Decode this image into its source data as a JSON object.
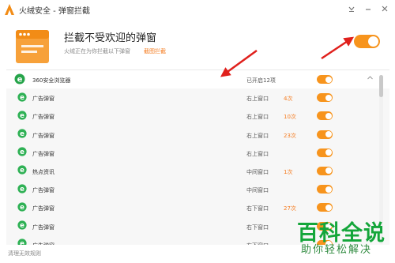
{
  "window": {
    "title": "火绒安全 - 弹窗拦截",
    "controls": [
      "menu-icon",
      "minimize-icon",
      "close-icon"
    ]
  },
  "header": {
    "title": "拦截不受欢迎的弹窗",
    "subtitle": "火绒正在为你拦截以下弹窗",
    "link": "截图拦截",
    "enabled": true
  },
  "group": {
    "name": "360安全浏览器",
    "status": "已开启12项",
    "enabled": true
  },
  "items": [
    {
      "name": "广告弹窗",
      "position": "右上窗口",
      "count": "4次",
      "enabled": true
    },
    {
      "name": "广告弹窗",
      "position": "右上窗口",
      "count": "10次",
      "enabled": true
    },
    {
      "name": "广告弹窗",
      "position": "右上窗口",
      "count": "23次",
      "enabled": true
    },
    {
      "name": "广告弹窗",
      "position": "右上窗口",
      "count": "",
      "enabled": true
    },
    {
      "name": "热点资讯",
      "position": "中间窗口",
      "count": "1次",
      "enabled": true
    },
    {
      "name": "广告弹窗",
      "position": "中间窗口",
      "count": "",
      "enabled": true
    },
    {
      "name": "广告弹窗",
      "position": "右下窗口",
      "count": "27次",
      "enabled": true
    },
    {
      "name": "广告弹窗",
      "position": "右下窗口",
      "count": "",
      "enabled": true
    },
    {
      "name": "广告弹窗",
      "position": "右下窗口",
      "count": "",
      "enabled": true
    }
  ],
  "footer": {
    "link": "清理无效规则"
  },
  "watermark": {
    "main": "百科全说",
    "sub": "助你轻松解决"
  },
  "colors": {
    "accent": "#f7941d",
    "link": "#f57c20",
    "arrow": "#e0201c",
    "watermark": "#14a63a"
  }
}
